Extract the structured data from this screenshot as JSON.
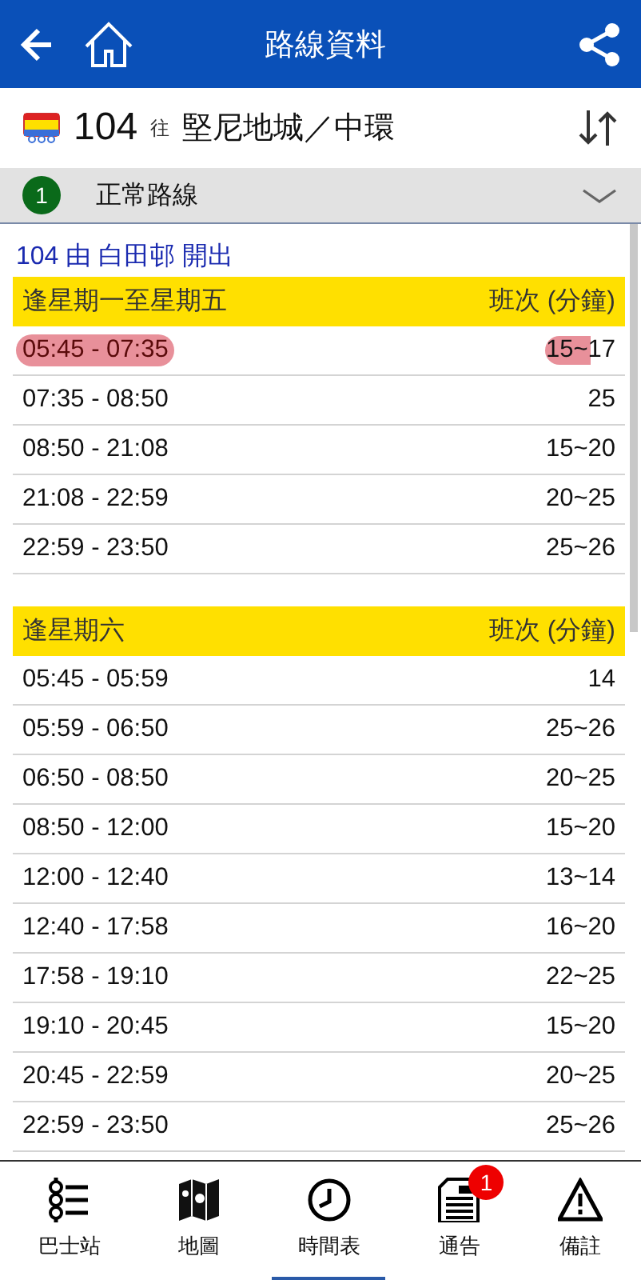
{
  "app_bar": {
    "title": "路線資料"
  },
  "route": {
    "number": "104",
    "direction_word": "往",
    "destination": "堅尼地城／中環"
  },
  "variant": {
    "badge": "1",
    "name": "正常路線",
    "expanded": false
  },
  "origin_line": "104 由 白田邨 開出",
  "timetables": [
    {
      "heading": "逢星期一至星期五",
      "column_label": "班次 (分鐘)",
      "rows": [
        {
          "period": "05:45 - 07:35",
          "frequency": "15~17",
          "highlighted": true
        },
        {
          "period": "07:35 - 08:50",
          "frequency": "25",
          "highlighted": false
        },
        {
          "period": "08:50 - 21:08",
          "frequency": "15~20",
          "highlighted": false
        },
        {
          "period": "21:08 - 22:59",
          "frequency": "20~25",
          "highlighted": false
        },
        {
          "period": "22:59 - 23:50",
          "frequency": "25~26",
          "highlighted": false
        }
      ]
    },
    {
      "heading": "逢星期六",
      "column_label": "班次 (分鐘)",
      "rows": [
        {
          "period": "05:45 - 05:59",
          "frequency": "14",
          "highlighted": false
        },
        {
          "period": "05:59 - 06:50",
          "frequency": "25~26",
          "highlighted": false
        },
        {
          "period": "06:50 - 08:50",
          "frequency": "20~25",
          "highlighted": false
        },
        {
          "period": "08:50 - 12:00",
          "frequency": "15~20",
          "highlighted": false
        },
        {
          "period": "12:00 - 12:40",
          "frequency": "13~14",
          "highlighted": false
        },
        {
          "period": "12:40 - 17:58",
          "frequency": "16~20",
          "highlighted": false
        },
        {
          "period": "17:58 - 19:10",
          "frequency": "22~25",
          "highlighted": false
        },
        {
          "period": "19:10 - 20:45",
          "frequency": "15~20",
          "highlighted": false
        },
        {
          "period": "20:45 - 22:59",
          "frequency": "20~25",
          "highlighted": false
        },
        {
          "period": "22:59 - 23:50",
          "frequency": "25~26",
          "highlighted": false
        }
      ]
    }
  ],
  "bottom_tabs": [
    {
      "kind": "stops",
      "label": "巴士站",
      "selected": false
    },
    {
      "kind": "map",
      "label": "地圖",
      "selected": false
    },
    {
      "kind": "timetable",
      "label": "時間表",
      "selected": true
    },
    {
      "kind": "notices",
      "label": "通告",
      "selected": false,
      "badge": "1"
    },
    {
      "kind": "remarks",
      "label": "備註",
      "selected": false
    }
  ]
}
